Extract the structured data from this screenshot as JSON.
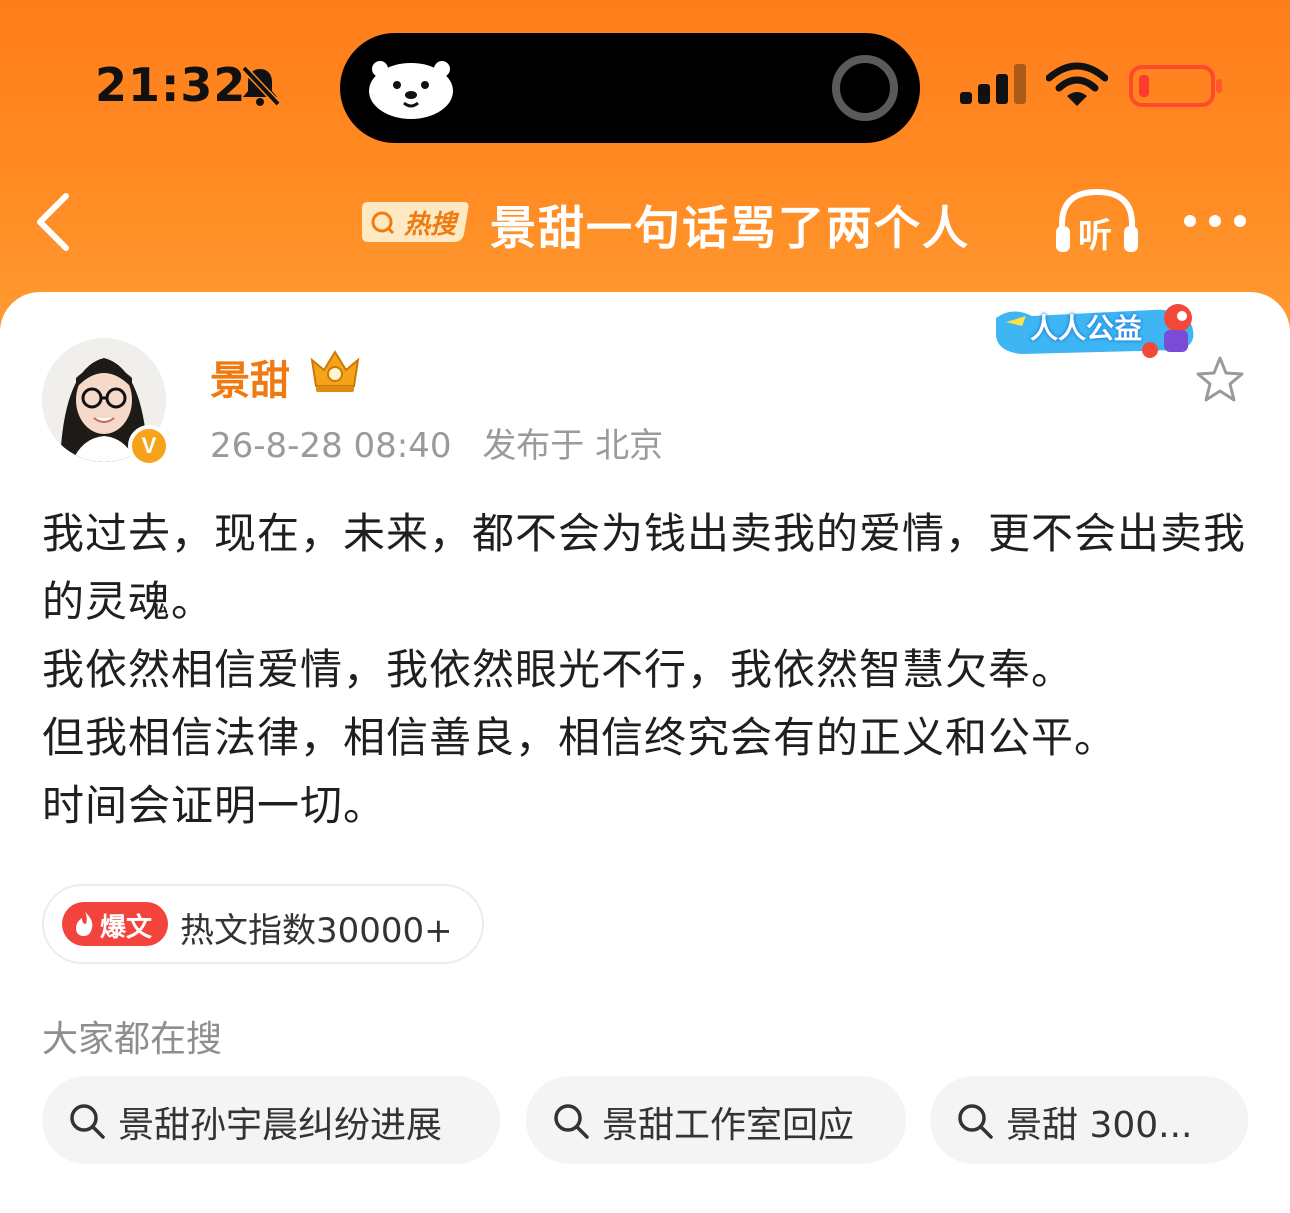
{
  "status_bar": {
    "time": "21:32",
    "icons": [
      "bell-slash-icon",
      "signal-icon",
      "wifi-icon",
      "battery-icon"
    ]
  },
  "nav": {
    "hot_badge": "热搜",
    "title": "景甜一句话骂了两个人",
    "listen_label": "听"
  },
  "post": {
    "author": "景甜",
    "verified_badge": "V",
    "date": "26-8-28 08:40",
    "location": "发布于 北京",
    "charity_banner": "人人公益",
    "body": [
      "我过去，现在，未来，都不会为钱出卖我的爱情，更不会出卖我的灵魂。",
      "我依然相信爱情，我依然眼光不行，我依然智慧欠奉。",
      "但我相信法律，相信善良，相信终究会有的正义和公平。",
      "时间会证明一切。"
    ],
    "hot_tag": "爆文",
    "hot_index": "热文指数30000+"
  },
  "related_search": {
    "title": "大家都在搜",
    "items": [
      "景甜孙宇晨纠纷进展",
      "景甜工作室回应",
      "景甜 300..."
    ]
  },
  "colors": {
    "header_orange": "#ff8a22",
    "username_orange": "#f07a12",
    "hot_red": "#f2443d",
    "battery_red": "#ff3b30"
  }
}
